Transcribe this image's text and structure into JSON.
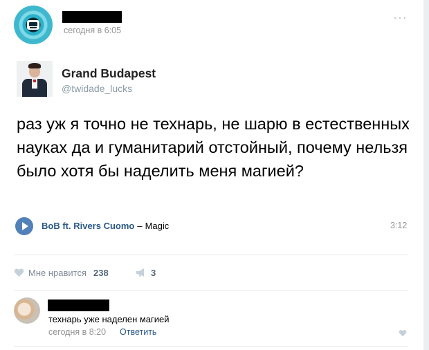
{
  "post": {
    "time": "сегодня в 6:05",
    "menu_glyph": "···",
    "tweet": {
      "name": "Grand Budapest",
      "handle": "@twidade_lucks"
    },
    "text": "раз уж я точно не технарь, не шарю в естественных науках да и гуманитарий отстойный, почему нельзя было хотя бы наделить меня магией?",
    "audio": {
      "artist": "BoB ft. Rivers Cuomo",
      "separator": "–",
      "title": "Magic",
      "duration": "3:12"
    },
    "actions": {
      "like_label": "Мне нравится",
      "like_count": "238",
      "share_count": "3"
    }
  },
  "comment": {
    "text": "технарь уже наделен магией",
    "time": "сегодня в 8:20",
    "reply_label": "Ответить"
  },
  "colors": {
    "link": "#2a5885",
    "muted": "#939393",
    "accent": "#5181b8"
  }
}
